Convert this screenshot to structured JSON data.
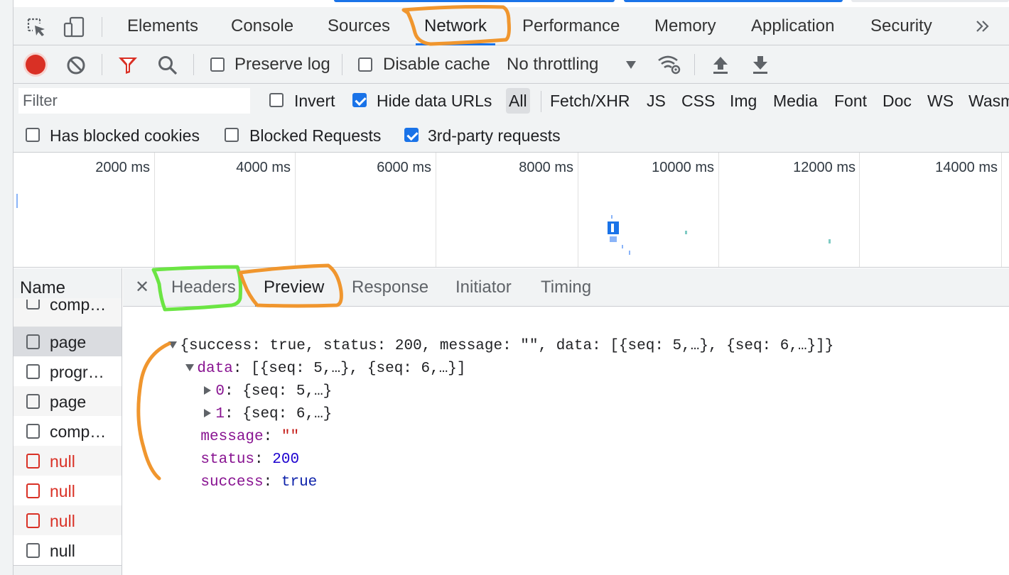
{
  "main_tabs": [
    {
      "label": "Elements"
    },
    {
      "label": "Console"
    },
    {
      "label": "Sources"
    },
    {
      "label": "Network",
      "active": true
    },
    {
      "label": "Performance"
    },
    {
      "label": "Memory"
    },
    {
      "label": "Application"
    },
    {
      "label": "Security"
    }
  ],
  "toolbar": {
    "preserve_log": "Preserve log",
    "disable_cache": "Disable cache",
    "throttling": "No throttling"
  },
  "filter": {
    "placeholder": "Filter",
    "invert": "Invert",
    "hide_data_urls": "Hide data URLs",
    "types": [
      "All",
      "Fetch/XHR",
      "JS",
      "CSS",
      "Img",
      "Media",
      "Font",
      "Doc",
      "WS",
      "Wasm"
    ],
    "has_blocked_cookies": "Has blocked cookies",
    "blocked_requests": "Blocked Requests",
    "third_party": "3rd-party requests"
  },
  "timeline": {
    "ticks": [
      "2000 ms",
      "4000 ms",
      "6000 ms",
      "8000 ms",
      "10000 ms",
      "12000 ms",
      "14000 ms"
    ]
  },
  "name_column": {
    "header": "Name",
    "rows": [
      {
        "name": "comp…",
        "error": false
      },
      {
        "name": "page",
        "error": false,
        "selected": true
      },
      {
        "name": "progr…",
        "error": false
      },
      {
        "name": "page",
        "error": false
      },
      {
        "name": "comp…",
        "error": false
      },
      {
        "name": "null",
        "error": true
      },
      {
        "name": "null",
        "error": true
      },
      {
        "name": "null",
        "error": true
      },
      {
        "name": "null",
        "error": false
      }
    ]
  },
  "detail_tabs": [
    {
      "label": "Headers"
    },
    {
      "label": "Preview",
      "active": true
    },
    {
      "label": "Response"
    },
    {
      "label": "Initiator"
    },
    {
      "label": "Timing"
    }
  ],
  "preview": {
    "root_summary": "{success: true, status: 200, message: \"\", data: [{seq: 5,…}, {seq: 6,…}]}",
    "data_key": "data",
    "data_summary": "[{seq: 5,…}, {seq: 6,…}]",
    "item0_key": "0",
    "item0_summary": "{seq: 5,…}",
    "item1_key": "1",
    "item1_summary": "{seq: 6,…}",
    "message_key": "message",
    "message_value": "\"\"",
    "status_key": "status",
    "status_value": "200",
    "success_key": "success",
    "success_value": "true"
  },
  "colors": {
    "accent": "#1a73e8",
    "annotation_orange": "#f0962e",
    "annotation_green": "#6be543",
    "error_red": "#d93025"
  }
}
